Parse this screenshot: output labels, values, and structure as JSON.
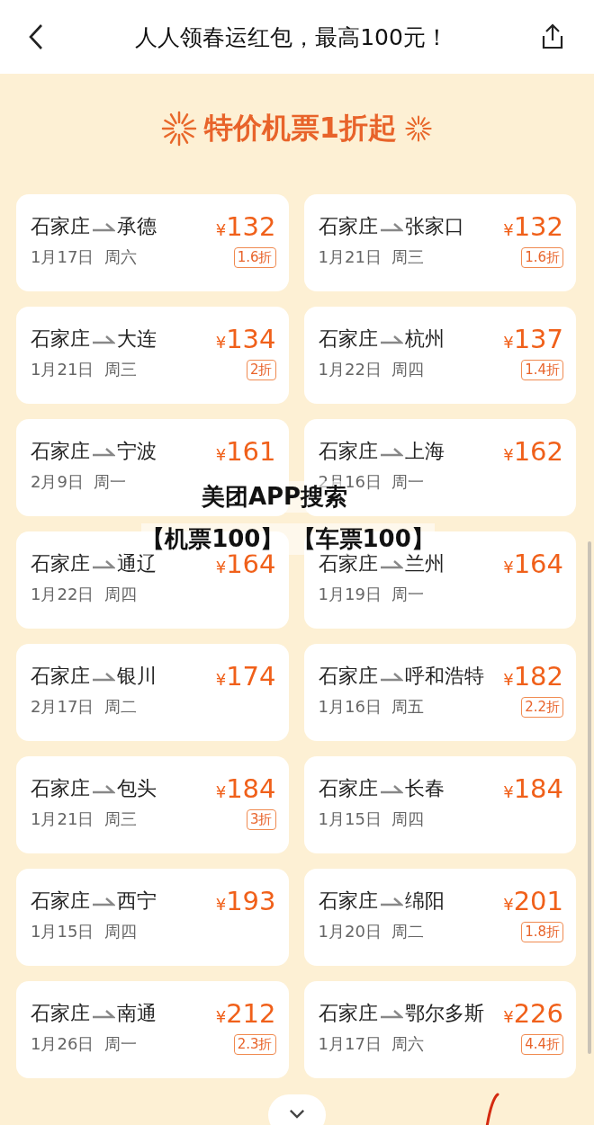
{
  "header": {
    "title": "人人领春运红包，最高100元！"
  },
  "banner": {
    "title": "特价机票1折起"
  },
  "fares": [
    {
      "origin": "石家庄",
      "destination": "承德",
      "currency": "¥",
      "amount": "132",
      "date": "1月17日",
      "weekday": "周六",
      "discount": "1.6折"
    },
    {
      "origin": "石家庄",
      "destination": "张家口",
      "currency": "¥",
      "amount": "132",
      "date": "1月21日",
      "weekday": "周三",
      "discount": "1.6折"
    },
    {
      "origin": "石家庄",
      "destination": "大连",
      "currency": "¥",
      "amount": "134",
      "date": "1月21日",
      "weekday": "周三",
      "discount": "2折"
    },
    {
      "origin": "石家庄",
      "destination": "杭州",
      "currency": "¥",
      "amount": "137",
      "date": "1月22日",
      "weekday": "周四",
      "discount": "1.4折"
    },
    {
      "origin": "石家庄",
      "destination": "宁波",
      "currency": "¥",
      "amount": "161",
      "date": "2月9日",
      "weekday": "周一"
    },
    {
      "origin": "石家庄",
      "destination": "上海",
      "currency": "¥",
      "amount": "162",
      "date": "2月16日",
      "weekday": "周一"
    },
    {
      "origin": "石家庄",
      "destination": "通辽",
      "currency": "¥",
      "amount": "164",
      "date": "1月22日",
      "weekday": "周四"
    },
    {
      "origin": "石家庄",
      "destination": "兰州",
      "currency": "¥",
      "amount": "164",
      "date": "1月19日",
      "weekday": "周一"
    },
    {
      "origin": "石家庄",
      "destination": "银川",
      "currency": "¥",
      "amount": "174",
      "date": "2月17日",
      "weekday": "周二"
    },
    {
      "origin": "石家庄",
      "destination": "呼和浩特",
      "currency": "¥",
      "amount": "182",
      "date": "1月16日",
      "weekday": "周五",
      "discount": "2.2折"
    },
    {
      "origin": "石家庄",
      "destination": "包头",
      "currency": "¥",
      "amount": "184",
      "date": "1月21日",
      "weekday": "周三",
      "discount": "3折"
    },
    {
      "origin": "石家庄",
      "destination": "长春",
      "currency": "¥",
      "amount": "184",
      "date": "1月15日",
      "weekday": "周四"
    },
    {
      "origin": "石家庄",
      "destination": "西宁",
      "currency": "¥",
      "amount": "193",
      "date": "1月15日",
      "weekday": "周四"
    },
    {
      "origin": "石家庄",
      "destination": "绵阳",
      "currency": "¥",
      "amount": "201",
      "date": "1月20日",
      "weekday": "周二",
      "discount": "1.8折"
    },
    {
      "origin": "石家庄",
      "destination": "南通",
      "currency": "¥",
      "amount": "212",
      "date": "1月26日",
      "weekday": "周一",
      "discount": "2.3折"
    },
    {
      "origin": "石家庄",
      "destination": "鄂尔多斯",
      "currency": "¥",
      "amount": "226",
      "date": "1月17日",
      "weekday": "周六",
      "discount": "4.4折"
    }
  ],
  "overlay": {
    "lines": [
      "美团APP搜索",
      "【机票100】 【车票100】"
    ]
  }
}
